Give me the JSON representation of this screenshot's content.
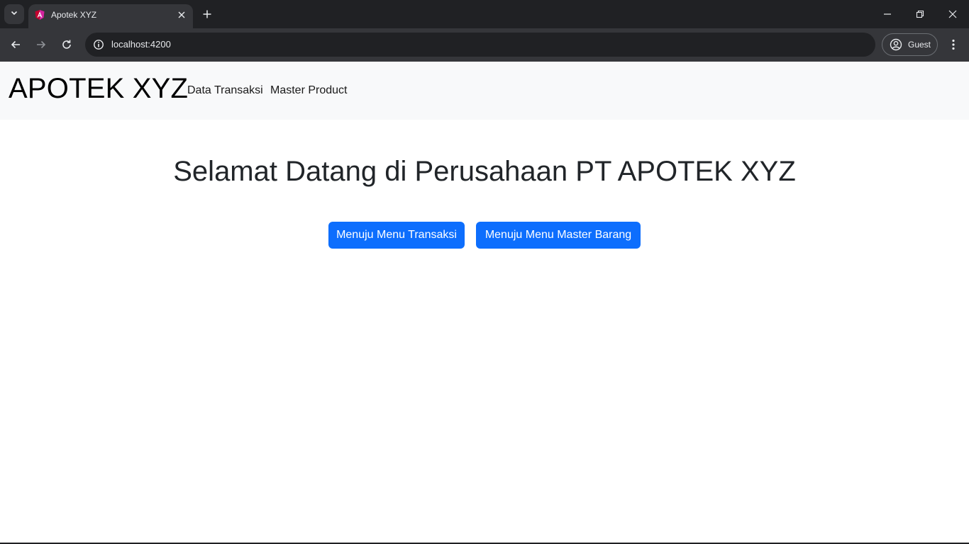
{
  "browser": {
    "tab_title": "Apotek XYZ",
    "url": "localhost:4200",
    "profile_label": "Guest"
  },
  "navbar": {
    "brand": "APOTEK XYZ",
    "links": [
      "Data Transaksi",
      "Master Product"
    ]
  },
  "main": {
    "heading": "Selamat Datang di Perusahaan PT APOTEK XYZ",
    "buttons": [
      "Menuju Menu Transaksi",
      "Menuju Menu Master Barang"
    ]
  },
  "colors": {
    "primary_button": "#0d6efd",
    "navbar_bg": "#f8f9fa",
    "chrome_dark": "#202124",
    "chrome_toolbar": "#35363a"
  }
}
